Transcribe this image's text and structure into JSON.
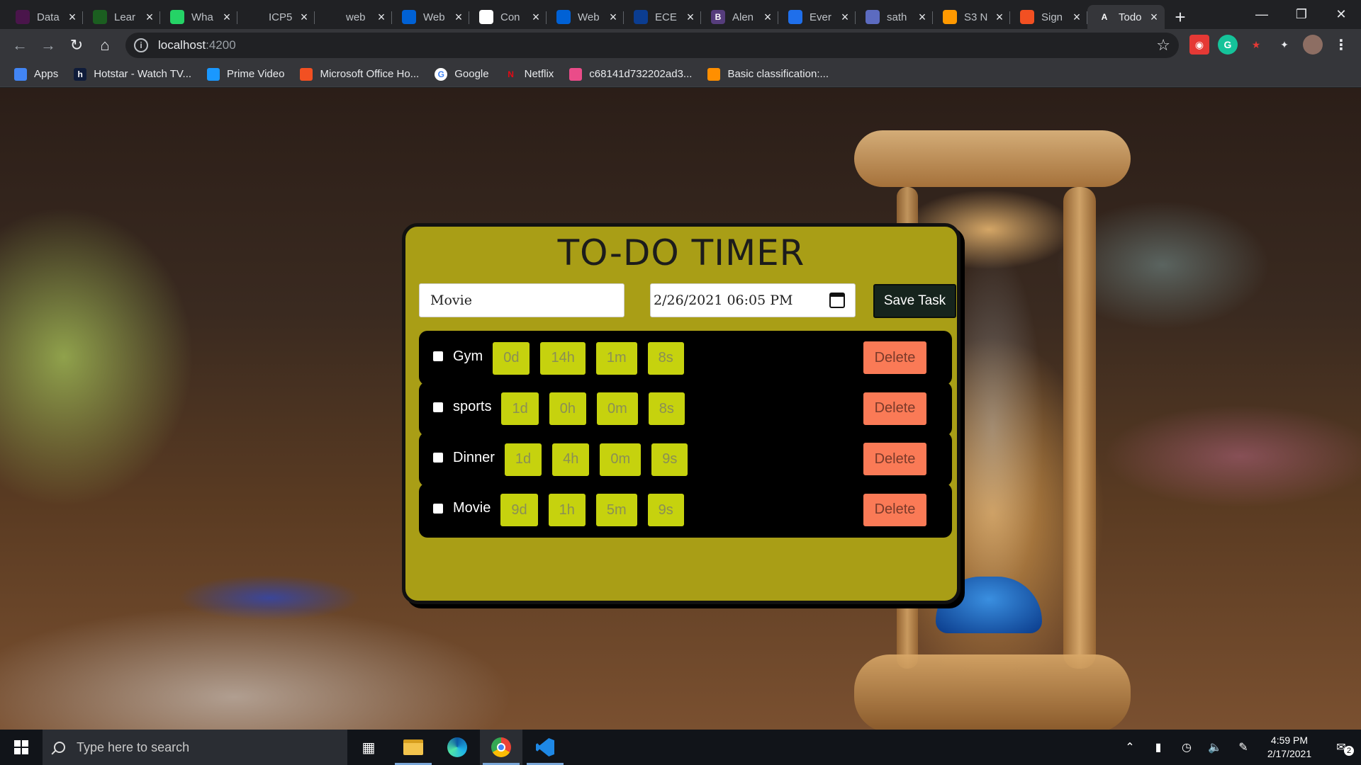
{
  "browser": {
    "tabs": [
      {
        "title": "Data",
        "favicon": "slack-icon",
        "color": "#4a154b"
      },
      {
        "title": "Lear",
        "favicon": "leaf-icon",
        "color": "#1b5e20"
      },
      {
        "title": "Wha",
        "favicon": "whatsapp-icon",
        "color": "#25d366"
      },
      {
        "title": "ICP5",
        "favicon": "github-icon",
        "color": "#202124"
      },
      {
        "title": "web",
        "favicon": "github-icon",
        "color": "#202124"
      },
      {
        "title": "Web",
        "favicon": "box-icon",
        "color": "#0061d5"
      },
      {
        "title": "Con",
        "favicon": "chart-icon",
        "color": "#ffffff"
      },
      {
        "title": "Web",
        "favicon": "box-icon",
        "color": "#0061d5"
      },
      {
        "title": "ECE",
        "favicon": "flag-icon",
        "color": "#0b3d91"
      },
      {
        "title": "Alen",
        "favicon": "bootstrap-icon",
        "color": "#563d7c"
      },
      {
        "title": "Ever",
        "favicon": "wave-icon",
        "color": "#1f6feb"
      },
      {
        "title": "sath",
        "favicon": "table-icon",
        "color": "#5c6bc0"
      },
      {
        "title": "S3 N",
        "favicon": "aws-box-icon",
        "color": "#ff9900"
      },
      {
        "title": "Sign",
        "favicon": "microsoft-icon",
        "color": "#f25022"
      },
      {
        "title": "Todo",
        "favicon": "angular-icon",
        "color": "#35363a",
        "active": true
      }
    ],
    "url_host": "localhost",
    "url_port": ":4200",
    "bookmarks": [
      {
        "label": "Apps",
        "icon": "apps-grid-icon",
        "color": "#4285f4"
      },
      {
        "label": "Hotstar - Watch TV...",
        "icon": "hotstar-icon",
        "color": "#0f1c3a"
      },
      {
        "label": "Prime Video",
        "icon": "prime-video-icon",
        "color": "#1a98ff"
      },
      {
        "label": "Microsoft Office Ho...",
        "icon": "microsoft-icon",
        "color": "#f25022"
      },
      {
        "label": "Google",
        "icon": "google-icon",
        "color": "#ffffff"
      },
      {
        "label": "Netflix",
        "icon": "netflix-icon",
        "color": "#e50914"
      },
      {
        "label": "c68141d732202ad3...",
        "icon": "dribbble-icon",
        "color": "#ea4c89"
      },
      {
        "label": "Basic classification:...",
        "icon": "tensorflow-icon",
        "color": "#ff8f00"
      }
    ]
  },
  "app": {
    "title": "TO-DO TIMER",
    "task_input_value": "Movie",
    "date_input_value": "2/26/2021 06:05 PM",
    "save_label": "Save Task",
    "delete_label": "Delete",
    "tasks": [
      {
        "name": "Gym",
        "days": "0d",
        "hours": "14h",
        "minutes": "1m",
        "seconds": "8s"
      },
      {
        "name": "sports",
        "days": "1d",
        "hours": "0h",
        "minutes": "0m",
        "seconds": "8s"
      },
      {
        "name": "Dinner",
        "days": "1d",
        "hours": "4h",
        "minutes": "0m",
        "seconds": "9s"
      },
      {
        "name": "Movie",
        "days": "9d",
        "hours": "1h",
        "minutes": "5m",
        "seconds": "9s"
      }
    ]
  },
  "taskbar": {
    "search_placeholder": "Type here to search",
    "time": "4:59 PM",
    "date": "2/17/2021",
    "notification_count": "2"
  }
}
